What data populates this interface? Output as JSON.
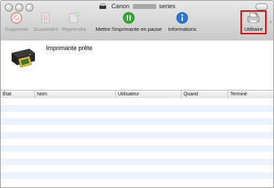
{
  "window": {
    "title_prefix": "Canon",
    "title_suffix": "series"
  },
  "toolbar": {
    "items": [
      {
        "label": "Supprimer",
        "icon": "delete-icon",
        "enabled": false
      },
      {
        "label": "Suspendre",
        "icon": "pause-job-icon",
        "enabled": false
      },
      {
        "label": "Reprendre",
        "icon": "resume-job-icon",
        "enabled": false
      },
      {
        "label": "Mettre l'imprimante en pause",
        "icon": "pause-printer-icon",
        "enabled": true
      },
      {
        "label": "Informations",
        "icon": "info-icon",
        "enabled": true
      },
      {
        "label": "Utilitaire",
        "icon": "utility-icon",
        "enabled": true,
        "highlighted": true
      }
    ]
  },
  "status": {
    "text": "Imprimante prête"
  },
  "table": {
    "columns": [
      "État",
      "Nom",
      "Utilisateur",
      "Quand",
      "Terminé"
    ],
    "rows": []
  },
  "colors": {
    "highlight": "#e00000",
    "pause_green": "#2fae2f",
    "info_blue": "#2a78d8",
    "row_stripe": "#edf3fe"
  }
}
